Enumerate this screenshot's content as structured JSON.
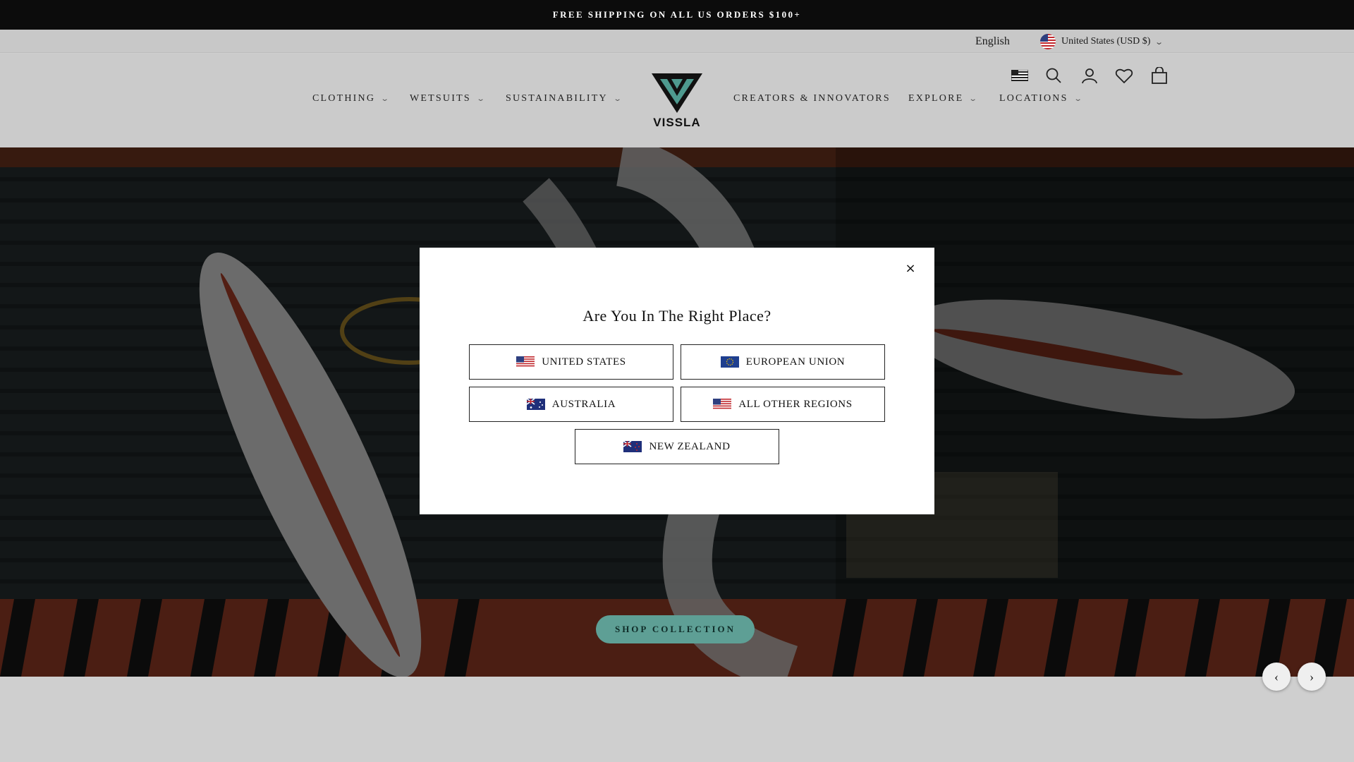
{
  "announcement": {
    "text": "FREE SHIPPING ON ALL US ORDERS $100+"
  },
  "utility": {
    "language": "English",
    "currency": "United States (USD $)"
  },
  "nav": {
    "left": [
      {
        "label": "CLOTHING",
        "dropdown": true
      },
      {
        "label": "WETSUITS",
        "dropdown": true
      },
      {
        "label": "SUSTAINABILITY",
        "dropdown": true
      }
    ],
    "right": [
      {
        "label": "CREATORS & INNOVATORS",
        "dropdown": false
      },
      {
        "label": "EXPLORE",
        "dropdown": true
      },
      {
        "label": "LOCATIONS",
        "dropdown": true
      }
    ],
    "logo_text": "VISSLA",
    "icons": [
      "flag-icon",
      "search-icon",
      "account-icon",
      "wishlist-icon",
      "cart-icon"
    ]
  },
  "hero": {
    "cta_label": "SHOP COLLECTION",
    "prev_label": "‹",
    "next_label": "›"
  },
  "modal": {
    "title": "Are You In The Right Place?",
    "close_label": "×",
    "regions": [
      {
        "label": "UNITED STATES",
        "flag": "us-flag-icon"
      },
      {
        "label": "EUROPEAN UNION",
        "flag": "eu-flag-icon"
      },
      {
        "label": "AUSTRALIA",
        "flag": "au-flag-icon"
      },
      {
        "label": "ALL OTHER REGIONS",
        "flag": "us-flag-icon"
      },
      {
        "label": "NEW ZEALAND",
        "flag": "nz-flag-icon"
      }
    ]
  },
  "colors": {
    "accent": "#5e9f95",
    "announcement_bg": "#0c0c0c",
    "header_bg": "#cbcbcb"
  }
}
